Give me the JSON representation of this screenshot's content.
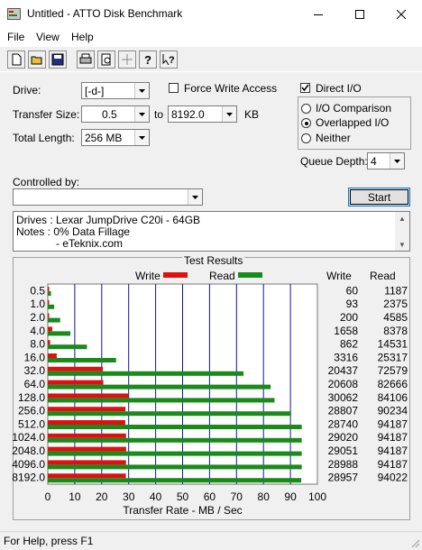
{
  "window": {
    "title": "Untitled - ATTO Disk Benchmark"
  },
  "menu": {
    "items": [
      "File",
      "View",
      "Help"
    ]
  },
  "toolbar": {
    "icons": [
      "new-document-icon",
      "open-folder-icon",
      "save-icon",
      "print-icon",
      "print-preview-icon",
      "move-icon",
      "help-icon",
      "context-help-icon"
    ]
  },
  "drive": {
    "label": "Drive:",
    "value": "[-d-]"
  },
  "transfer_size": {
    "label": "Transfer Size:",
    "from": "0.5",
    "to_label": "to",
    "to": "8192.0",
    "unit": "KB"
  },
  "total_length": {
    "label": "Total Length:",
    "value": "256 MB"
  },
  "force_write": {
    "label": "Force Write Access",
    "checked": false
  },
  "direct_io": {
    "label": "Direct I/O",
    "checked": true
  },
  "io_modes": [
    {
      "label": "I/O Comparison",
      "selected": false
    },
    {
      "label": "Overlapped I/O",
      "selected": true
    },
    {
      "label": "Neither",
      "selected": false
    }
  ],
  "queue_depth": {
    "label": "Queue Depth:",
    "value": "4"
  },
  "controlled_by": {
    "label": "Controlled by:",
    "value": ""
  },
  "start_button": "Start",
  "notes": [
    "Drives : Lexar JumpDrive C20i - 64GB",
    "Notes : 0% Data Fillage",
    "- eTeknix.com"
  ],
  "results": {
    "title": "Test Results",
    "legend_write": "Write",
    "legend_read": "Read",
    "col_write": "Write",
    "col_read": "Read"
  },
  "colors": {
    "write": "#e01010",
    "read": "#1a8a1a",
    "grid": "#1010a0"
  },
  "chart_data": {
    "type": "bar",
    "orientation": "horizontal",
    "categories": [
      "0.5",
      "1.0",
      "2.0",
      "4.0",
      "8.0",
      "16.0",
      "32.0",
      "64.0",
      "128.0",
      "256.0",
      "512.0",
      "1024.0",
      "2048.0",
      "4096.0",
      "8192.0"
    ],
    "series": [
      {
        "name": "Write",
        "values": [
          60,
          93,
          200,
          1658,
          862,
          3316,
          20437,
          20608,
          30062,
          28807,
          28740,
          29020,
          29051,
          28988,
          28957
        ]
      },
      {
        "name": "Read",
        "values": [
          1187,
          2375,
          4585,
          8378,
          14531,
          25317,
          72579,
          82666,
          84106,
          90234,
          94187,
          94187,
          94187,
          94187,
          94022
        ]
      }
    ],
    "xlabel": "Transfer Rate - MB / Sec",
    "xticks": [
      "0",
      "10",
      "20",
      "30",
      "40",
      "50",
      "60",
      "70",
      "80",
      "90",
      "100"
    ],
    "xlim": [
      0,
      100
    ],
    "grid": true,
    "legend_position": "top"
  },
  "status": "For Help, press F1"
}
